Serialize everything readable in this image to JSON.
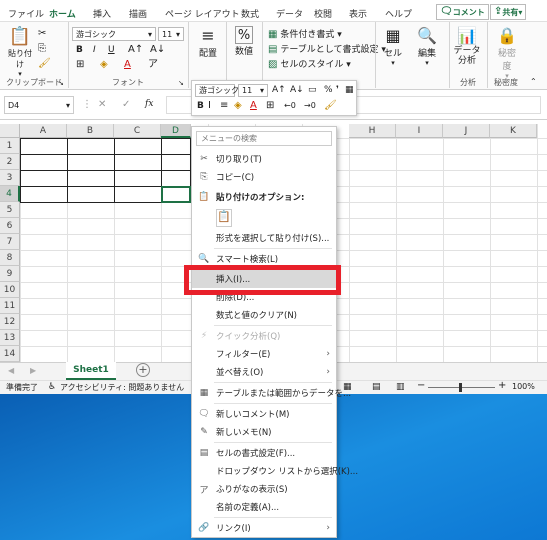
{
  "ribbon_tabs": [
    "ファイル",
    "ホーム",
    "挿入",
    "描画",
    "ページ レイアウト",
    "数式",
    "データ",
    "校閲",
    "表示",
    "ヘルプ"
  ],
  "active_tab": "ホーム",
  "comment_button": "コメント",
  "share_button": "共有",
  "clipboard": {
    "paste_label": "貼り付け",
    "group_label": "クリップボード"
  },
  "font": {
    "name": "游ゴシック",
    "size": "11",
    "group_label": "フォント",
    "bold": "B",
    "italic": "I",
    "underline": "U"
  },
  "alignment": {
    "label": "配置"
  },
  "number": {
    "label": "数値",
    "percent": "%"
  },
  "styles": {
    "conditional": "条件付き書式",
    "table": "テーブルとして書式設定",
    "cell_style": "セルのスタイル"
  },
  "cells": {
    "label": "セル"
  },
  "editing": {
    "label": "編集"
  },
  "analysis": {
    "label": "データ\n分析",
    "group_label": "分析"
  },
  "sensitivity": {
    "label": "秘密度",
    "group_label": "秘密度"
  },
  "name_box": "D4",
  "fx_label": "fx",
  "mini_toolbar": {
    "font": "游ゴシック",
    "size": "11"
  },
  "columns": [
    "A",
    "B",
    "C",
    "D",
    "E",
    "F",
    "G",
    "H",
    "I",
    "J",
    "K"
  ],
  "rows": [
    "1",
    "2",
    "3",
    "4",
    "5",
    "6",
    "7",
    "8",
    "9",
    "10",
    "11",
    "12",
    "13",
    "14"
  ],
  "sheet_tab": "Sheet1",
  "add_sheet": "+",
  "status": {
    "ready": "準備完了",
    "accessibility": "アクセシビリティ: 問題ありません",
    "zoom": "100%"
  },
  "context_menu": {
    "search_placeholder": "メニューの検索",
    "items": [
      {
        "label": "切り取り(T)",
        "icon": "cut-icon"
      },
      {
        "label": "コピー(C)",
        "icon": "copy-icon"
      },
      {
        "label": "貼り付けのオプション:",
        "icon": "paste-icon",
        "bold": true
      },
      {
        "label": "形式を選択して貼り付け(S)...",
        "icon": ""
      },
      {
        "label": "スマート検索(L)",
        "icon": "search-icon"
      },
      {
        "label": "挿入(I)...",
        "icon": ""
      },
      {
        "label": "削除(D)...",
        "icon": ""
      },
      {
        "label": "数式と値のクリア(N)",
        "icon": ""
      },
      {
        "label": "クイック分析(Q)",
        "icon": "quick-analysis-icon",
        "disabled": true
      },
      {
        "label": "フィルター(E)",
        "icon": "",
        "submenu": true
      },
      {
        "label": "並べ替え(O)",
        "icon": "",
        "submenu": true
      },
      {
        "label": "テーブルまたは範囲からデータを...",
        "icon": "table-icon"
      },
      {
        "label": "新しいコメント(M)",
        "icon": "comment-icon"
      },
      {
        "label": "新しいメモ(N)",
        "icon": "note-icon"
      },
      {
        "label": "セルの書式設定(F)...",
        "icon": "format-cells-icon"
      },
      {
        "label": "ドロップダウン リストから選択(K)...",
        "icon": ""
      },
      {
        "label": "ふりがなの表示(S)",
        "icon": "furigana-icon"
      },
      {
        "label": "名前の定義(A)...",
        "icon": ""
      },
      {
        "label": "リンク(I)",
        "icon": "link-icon",
        "submenu": true
      }
    ]
  },
  "colors": {
    "accent": "#1e7145",
    "highlight": "#e8202a",
    "desktop": "#0d78d4"
  }
}
